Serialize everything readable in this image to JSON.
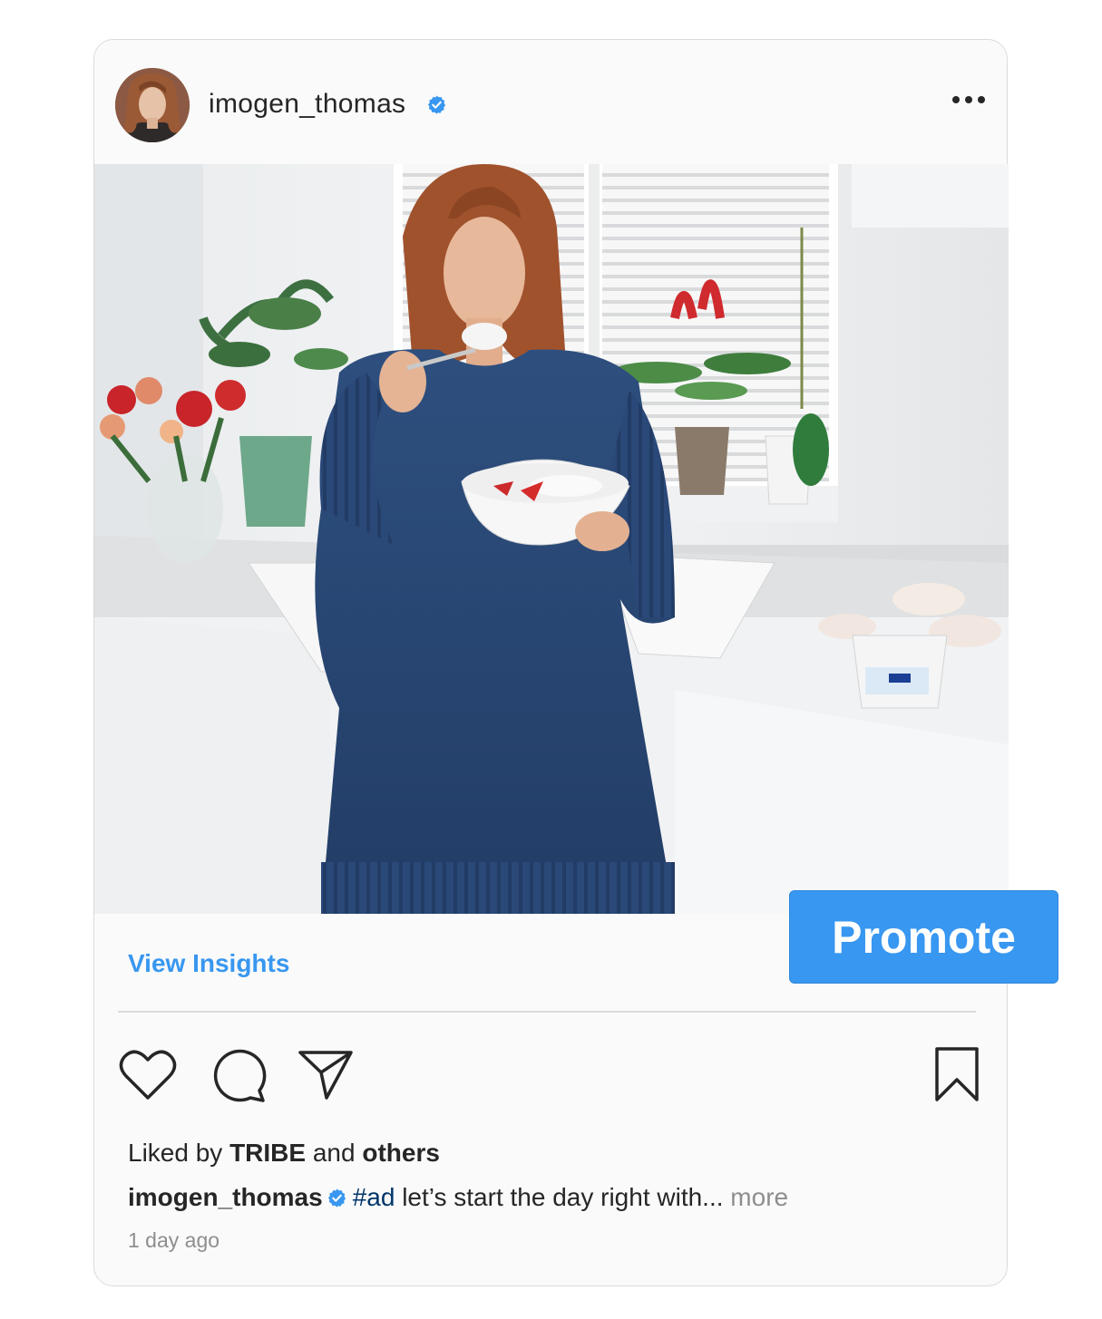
{
  "post": {
    "username": "imogen_thomas",
    "verified": true,
    "image_alt": "Woman in a blue sweater eating yogurt with strawberries in a white kitchen"
  },
  "actions": {
    "promote_label": "Promote",
    "insights_label": "View Insights"
  },
  "likes": {
    "prefix": "Liked by",
    "first": "TRIBE",
    "joiner": "and",
    "rest": "others"
  },
  "caption": {
    "username": "imogen_thomas",
    "hashtag": "#ad",
    "text": " let’s start the day right with...",
    "more": "more"
  },
  "timestamp": "1 day ago",
  "icons": [
    "more-horizontal-icon",
    "verified-badge-icon",
    "heart-icon",
    "comment-icon",
    "share-icon",
    "bookmark-icon"
  ],
  "colors": {
    "accent": "#3897f0",
    "verified": "#3897f0",
    "hashtag": "#003569",
    "muted": "#8e8e8e",
    "text": "#262626"
  }
}
